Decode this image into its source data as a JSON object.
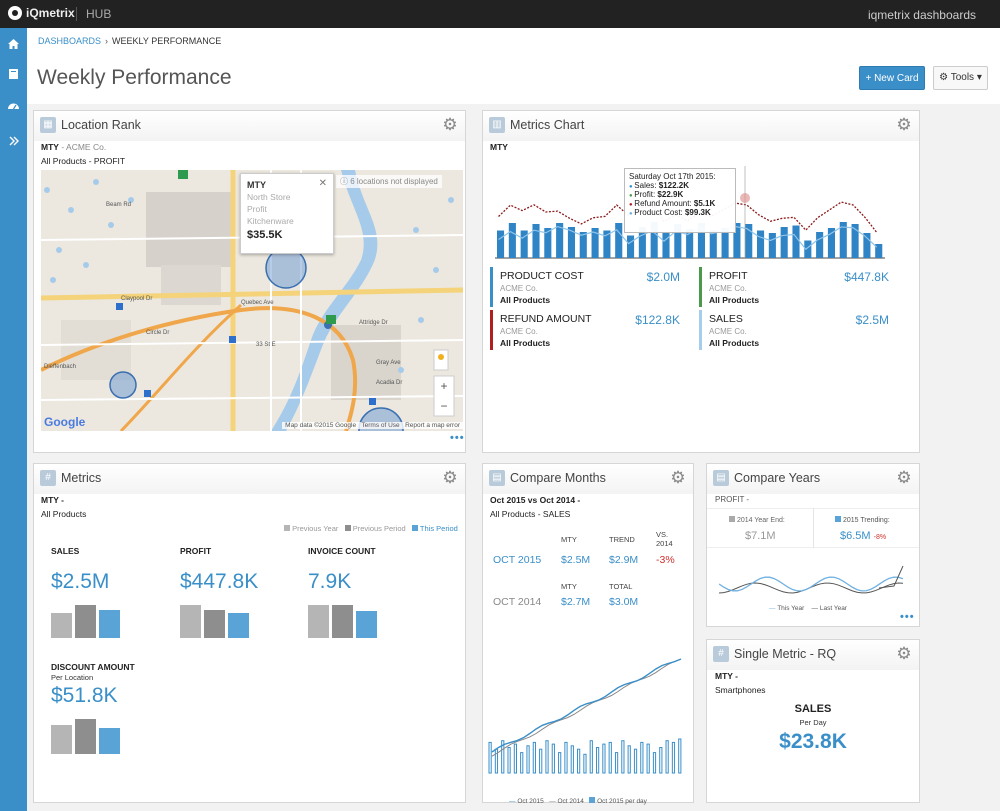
{
  "topbar": {
    "brand": "iQmetrix",
    "hub": "HUB",
    "account": "iqmetrix dashboards"
  },
  "sidebar": {
    "icons": [
      "home-icon",
      "book-icon",
      "dashboard-icon",
      "expand-icon"
    ]
  },
  "breadcrumb": {
    "root": "DASHBOARDS",
    "separator": "›",
    "current": "WEEKLY PERFORMANCE"
  },
  "page": {
    "title": "Weekly Performance",
    "new_card": "+ New Card",
    "tools": "⚙ Tools ▾"
  },
  "location_rank": {
    "title": "Location Rank",
    "sub1_strong": "MTY",
    "sub1_muted": " - ACME Co.",
    "sub2": "All Products - PROFIT",
    "popup": {
      "title": "MTY",
      "line1": "North Store",
      "line2": "Profit",
      "line3": "Kitchenware",
      "value": "$35.5K",
      "close": "✕"
    },
    "hidden_note": "6 locations not displayed",
    "footer": "Map data ©2015 Google   Terms of Use   Report a map error",
    "google": "Google",
    "map_labels": [
      "Beam Rd",
      "Claypool Dr",
      "Dieffenbach",
      "Quebec Ave",
      "Attridge Dr",
      "33 St E",
      "Circle Dr",
      "Gray Ave",
      "Acadia Dr"
    ],
    "more": "•••"
  },
  "metrics_chart": {
    "title": "Metrics Chart",
    "sub1": "MTY",
    "tooltip": {
      "date": "Saturday Oct 17th 2015:",
      "rows": [
        {
          "label": "Sales:",
          "value": "$122.2K",
          "color": "#3a8fc9"
        },
        {
          "label": "Profit:",
          "value": "$22.9K",
          "color": "#4a9a4a"
        },
        {
          "label": "Refund Amount:",
          "value": "$5.1K",
          "color": "#b01f1f"
        },
        {
          "label": "Product Cost:",
          "value": "$99.3K",
          "color": "#6fb0e0"
        }
      ]
    },
    "bars": [
      0.55,
      0.7,
      0.55,
      0.68,
      0.6,
      0.7,
      0.62,
      0.52,
      0.6,
      0.55,
      0.7,
      0.45,
      0.62,
      0.72,
      0.5,
      0.68,
      0.58,
      0.7,
      0.55,
      0.6,
      0.7,
      0.68,
      0.55,
      0.5,
      0.62,
      0.65,
      0.35,
      0.52,
      0.6,
      0.72,
      0.68,
      0.5,
      0.28
    ],
    "kpis": [
      {
        "label": "PRODUCT COST",
        "value": "$2.0M",
        "company": "ACME Co.",
        "scope": "All Products",
        "color": "#3a8fc9"
      },
      {
        "label": "PROFIT",
        "value": "$447.8K",
        "company": "ACME Co.",
        "scope": "All Products",
        "color": "#4a9a4a"
      },
      {
        "label": "REFUND AMOUNT",
        "value": "$122.8K",
        "company": "ACME Co.",
        "scope": "All Products",
        "color": "#b01f1f"
      },
      {
        "label": "SALES",
        "value": "$2.5M",
        "company": "ACME Co.",
        "scope": "All Products",
        "color": "#a6cdeb"
      }
    ]
  },
  "metrics": {
    "title": "Metrics",
    "sub1": "MTY -",
    "sub2": "All Products",
    "legend": [
      "Previous Year",
      "Previous Period",
      "This Period"
    ],
    "items": [
      {
        "label": "SALES",
        "sublabel": "",
        "value": "$2.5M",
        "bars": [
          0.7,
          0.92,
          0.78
        ]
      },
      {
        "label": "PROFIT",
        "sublabel": "",
        "value": "$447.8K",
        "bars": [
          0.92,
          0.78,
          0.7
        ]
      },
      {
        "label": "INVOICE COUNT",
        "sublabel": "",
        "value": "7.9K",
        "bars": [
          0.92,
          0.92,
          0.75
        ]
      },
      {
        "label": "DISCOUNT AMOUNT",
        "sublabel": "Per Location",
        "value": "$51.8K",
        "bars": [
          0.8,
          0.97,
          0.72
        ]
      }
    ]
  },
  "compare_months": {
    "title": "Compare Months",
    "sub1": "Oct 2015 vs Oct 2014 -",
    "sub2": "All Products - SALES",
    "headers": [
      "MTY",
      "TREND",
      "VS. 2014"
    ],
    "row1": {
      "label": "OCT 2015",
      "mty": "$2.5M",
      "trend": "$2.9M",
      "vs": "-3%"
    },
    "headers2": [
      "MTY",
      "TOTAL"
    ],
    "row2": {
      "label": "OCT 2014",
      "mty": "$2.7M",
      "total": "$3.0M"
    },
    "legend": [
      "Oct 2015",
      "Oct 2014",
      "Oct 2015 per day"
    ],
    "daily": [
      0.9,
      0.7,
      0.95,
      0.75,
      0.85,
      0.6,
      0.8,
      0.9,
      0.7,
      0.95,
      0.85,
      0.6,
      0.9,
      0.8,
      0.7,
      0.55,
      0.95,
      0.75,
      0.85,
      0.9,
      0.6,
      0.95,
      0.8,
      0.7,
      0.9,
      0.85,
      0.6,
      0.75,
      0.95,
      0.9,
      1.0
    ]
  },
  "compare_years": {
    "title": "Compare Years",
    "sub1": "PROFIT -",
    "left_label": "2014 Year End:",
    "left_value": "$7.1M",
    "right_label": "2015 Trending:",
    "right_value": "$6.5M",
    "right_delta": "-8%",
    "legend": [
      "This Year",
      "Last Year"
    ],
    "more": "•••"
  },
  "single_metric": {
    "title": "Single Metric - RQ",
    "sub1": "MTY -",
    "sub2": "Smartphones",
    "label": "SALES",
    "sublabel": "Per Day",
    "value": "$23.8K"
  }
}
